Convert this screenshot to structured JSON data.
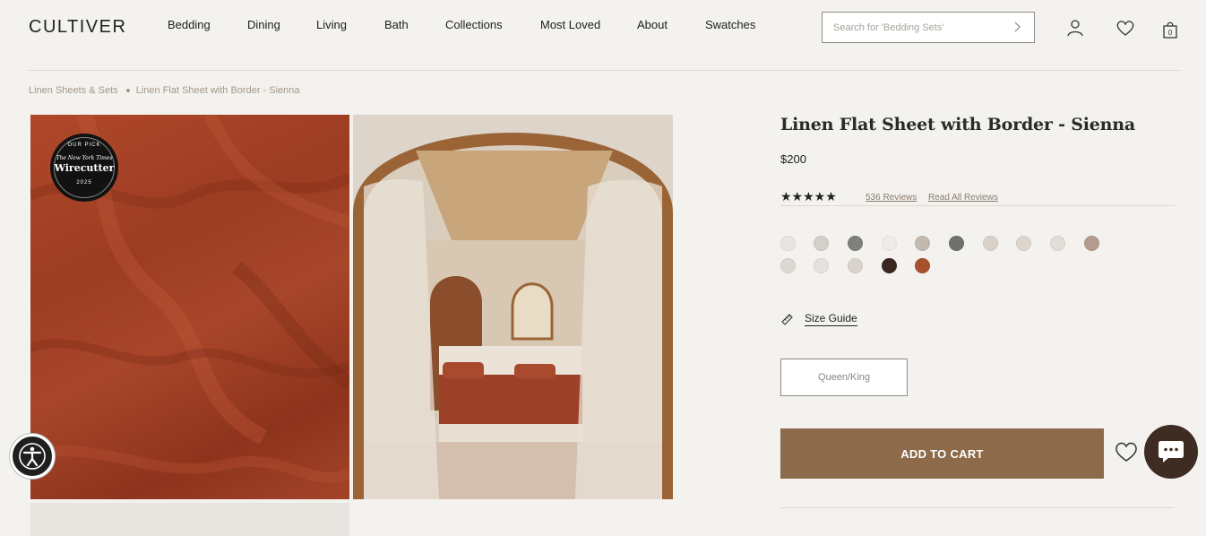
{
  "header": {
    "logo": "CULTIVER",
    "nav": [
      "Bedding",
      "Dining",
      "Living",
      "Bath",
      "Collections",
      "Most Loved",
      "About",
      "Swatches"
    ],
    "search_placeholder": "Search for 'Bedding Sets'",
    "cart_count": "0"
  },
  "breadcrumb": [
    "Linen Sheets & Sets",
    "Linen Flat Sheet with Border - Sienna"
  ],
  "badge": {
    "top": "OUR PICK",
    "publisher": "The New York Times",
    "name": "Wirecutter",
    "year": "2025"
  },
  "product": {
    "title": "Linen Flat Sheet with Border - Sienna",
    "price": "$200",
    "stars": "★★★★★",
    "rating": 5,
    "reviews_count": "536 Reviews",
    "read_all": "Read All Reviews",
    "swatches": [
      "#e8e6e2",
      "#d4cfc7",
      "#7f7f7b",
      "#efece8",
      "#c2bab0",
      "#6e716d",
      "#d9d2c8",
      "#dcd6ce",
      "#e2ddd6",
      "#b39c8d",
      "#dcd8d2",
      "#e4e2de",
      "#d9d3cb",
      "#3a2820",
      "#a9502d"
    ],
    "size_guide": "Size Guide",
    "size": "Queen/King",
    "add_to_cart": "ADD TO CART"
  },
  "colors": {
    "background": "#f4f2ee",
    "cart_button": "#8c6a4a",
    "chat_button": "#3e2c22",
    "accent_text": "#a39787"
  }
}
